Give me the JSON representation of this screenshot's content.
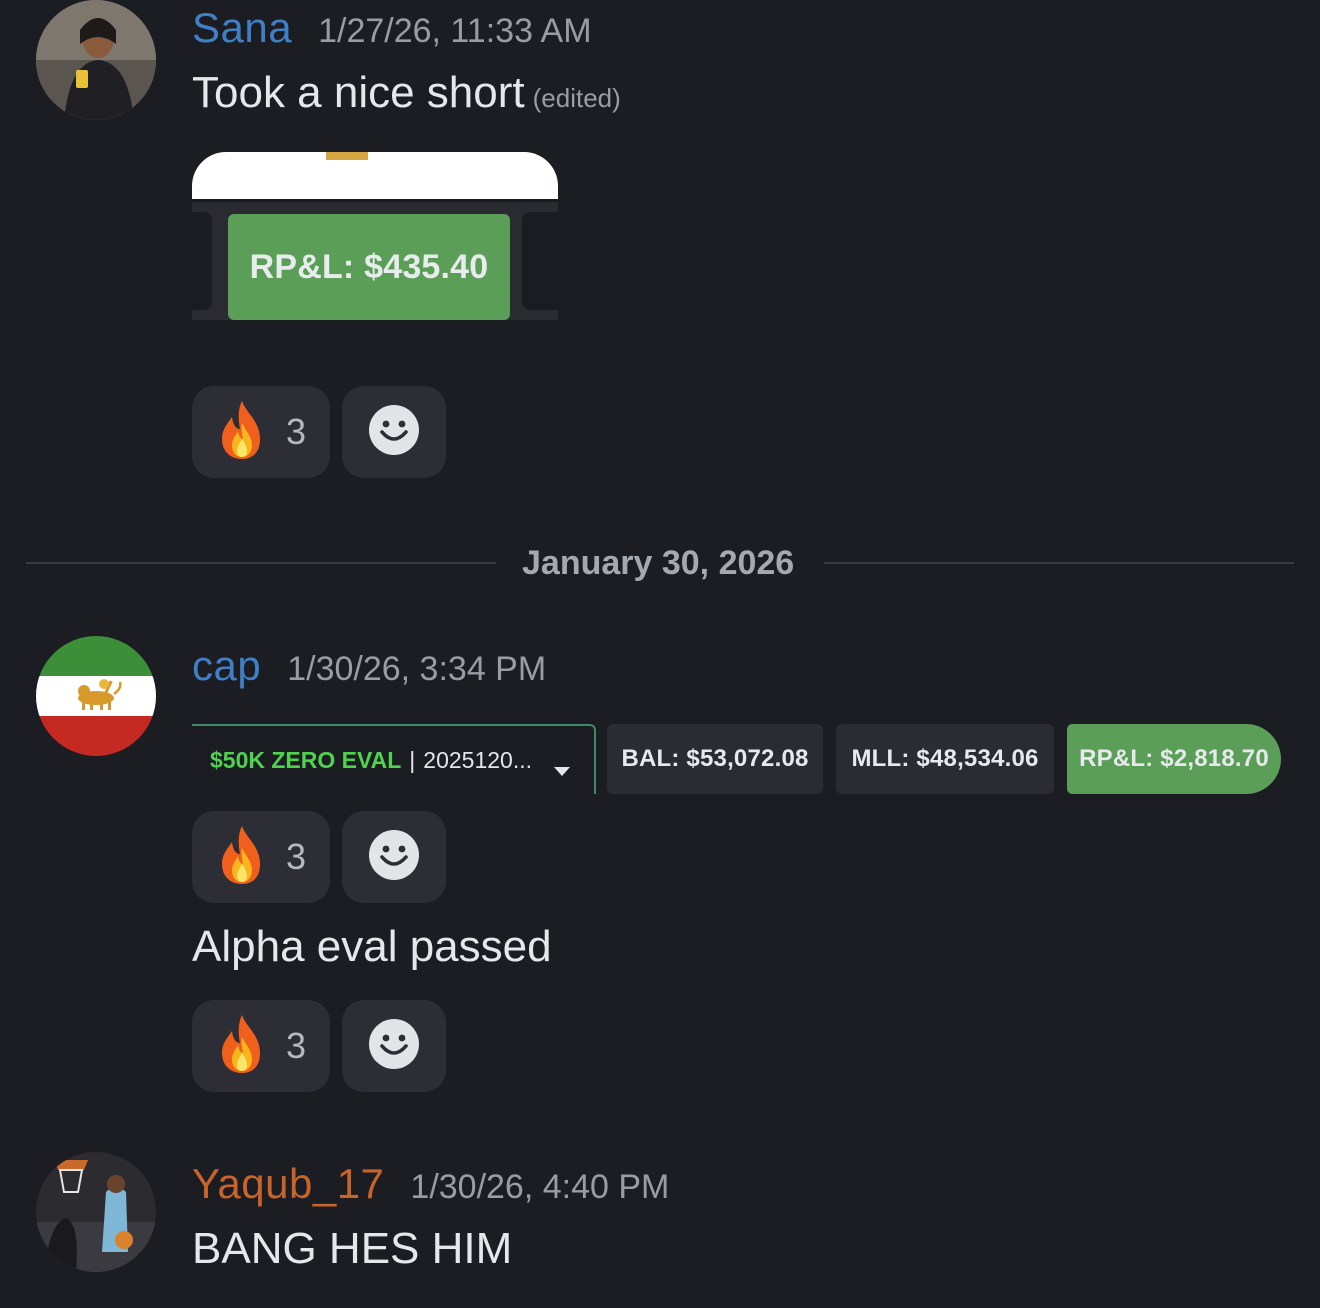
{
  "divider": {
    "date": "January 30, 2026"
  },
  "messages": [
    {
      "username": "Sana",
      "username_color": "#3f7fc6",
      "timestamp": "1/27/26, 11:33 AM",
      "text": "Took a nice short",
      "edited": "(edited)",
      "attachment": {
        "pnl_label": "RP&L: $435.40"
      },
      "reaction": {
        "emoji": "fire",
        "count": "3"
      }
    },
    {
      "username": "cap",
      "username_color": "#3f7fc6",
      "timestamp": "1/30/26, 3:34 PM",
      "attachment": {
        "account_name": "$50K ZERO EVAL",
        "account_sep": "|",
        "account_id": "2025120...",
        "bal": "BAL: $53,072.08",
        "mll": "MLL: $48,534.06",
        "rpl": "RP&L: $2,818.70"
      },
      "reaction": {
        "emoji": "fire",
        "count": "3"
      },
      "text": "Alpha eval passed",
      "reaction2": {
        "emoji": "fire",
        "count": "3"
      }
    },
    {
      "username": "Yaqub_17",
      "username_color": "#c8642a",
      "timestamp": "1/30/26, 4:40 PM",
      "text": "BANG HES HIM"
    }
  ],
  "colors": {
    "background": "#1c1d22",
    "pnl_green": "#5a9e58",
    "account_green": "#4ed34e"
  },
  "icons": [
    "fire-emoji-icon",
    "add-reaction-icon",
    "dropdown-caret-icon"
  ]
}
